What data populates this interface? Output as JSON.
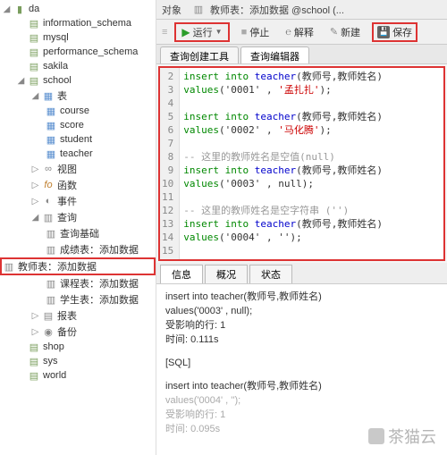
{
  "tree": {
    "root": "da",
    "dbs": [
      "information_schema",
      "mysql",
      "performance_schema",
      "sakila"
    ],
    "school": "school",
    "tables_label": "表",
    "tables": [
      "course",
      "score",
      "student",
      "teacher"
    ],
    "views": "视图",
    "functions": "函数",
    "events": "事件",
    "queries_label": "查询",
    "queries": [
      "查询基础",
      "成绩表：添加数据",
      "教师表：添加数据",
      "课程表：添加数据",
      "学生表：添加数据"
    ],
    "reports": "报表",
    "backup": "备份",
    "others": [
      "shop",
      "sys",
      "world"
    ]
  },
  "tabs": {
    "objects": "对象",
    "current": "教师表：添加数据 @school (..."
  },
  "toolbar": {
    "run": "运行",
    "stop": "停止",
    "explain": "解释",
    "new": "新建",
    "save": "保存"
  },
  "subtabs": {
    "builder": "查询创建工具",
    "editor": "查询编辑器"
  },
  "code": {
    "lines": [
      "2",
      "3",
      "4",
      "5",
      "6",
      "7",
      "8",
      "9",
      "10",
      "11",
      "12",
      "13",
      "14",
      "15"
    ],
    "l2a": "insert into ",
    "l2b": "teacher",
    "l2c": "(教师号,教师姓名)",
    "l3a": "values",
    "l3b": "('0001' , ",
    "l3c": "'孟扎扎'",
    "l3d": ");",
    "l5a": "insert into ",
    "l5b": "teacher",
    "l5c": "(教师号,教师姓名)",
    "l6a": "values",
    "l6b": "('0002' , ",
    "l6c": "'马化腾'",
    "l6d": ");",
    "c8": "-- 这里的教师姓名是空值(null)",
    "l9a": "insert into ",
    "l9b": "teacher",
    "l9c": "(教师号,教师姓名)",
    "l10a": "values",
    "l10b": "('0003' , null);",
    "c12": "-- 这里的教师姓名是空字符串 ('')",
    "l13a": "insert into ",
    "l13b": "teacher",
    "l13c": "(教师号,教师姓名)",
    "l14a": "values",
    "l14b": "('0004' , '');"
  },
  "outtabs": {
    "info": "信息",
    "profile": "概况",
    "status": "状态"
  },
  "output": {
    "l1": "insert into teacher(教师号,教师姓名)",
    "l2": "values('0003' , null);",
    "l3": "受影响的行: 1",
    "l4": "时间: 0.111s",
    "l5": "[SQL]",
    "l6": "insert into teacher(教师号,教师姓名)",
    "l7": "values('0004' , '');",
    "l8": "受影响的行: 1",
    "l9": "时间: 0.095s"
  },
  "watermark": "茶猫云"
}
